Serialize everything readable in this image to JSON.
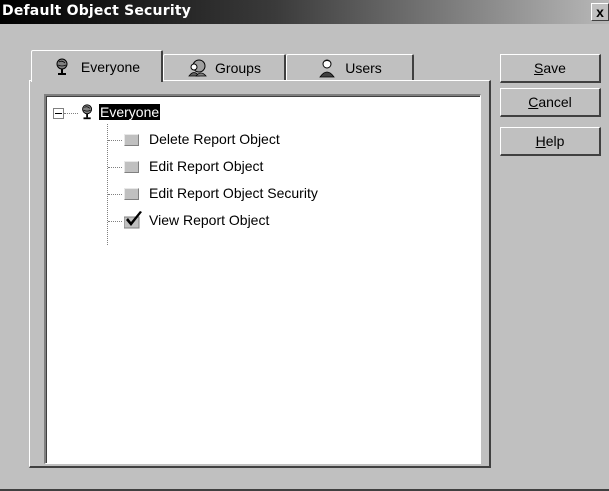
{
  "window": {
    "title": "Default Object Security",
    "close_glyph": "x"
  },
  "tabs": [
    {
      "label": "Everyone",
      "icon": "globe-person-icon",
      "active": true
    },
    {
      "label": "Groups",
      "icon": "groups-icon",
      "active": false
    },
    {
      "label": "Users",
      "icon": "user-icon",
      "active": false
    }
  ],
  "tree": {
    "root": {
      "label": "Everyone",
      "icon": "globe-person-icon",
      "expanded": true,
      "selected": true
    },
    "items": [
      {
        "label": "Delete Report Object",
        "granted": false
      },
      {
        "label": "Edit Report Object",
        "granted": false
      },
      {
        "label": "Edit Report Object Security",
        "granted": false
      },
      {
        "label": "View Report Object",
        "granted": true
      }
    ]
  },
  "buttons": {
    "save": {
      "mnemonic": "S",
      "rest": "ave"
    },
    "cancel": {
      "mnemonic": "C",
      "rest": "ancel"
    },
    "help": {
      "mnemonic": "H",
      "rest": "elp"
    }
  },
  "colors": {
    "face": "#c0c0c0",
    "selection": "#000000",
    "titlebar_start": "#000000",
    "titlebar_end": "#b8b8b8"
  }
}
